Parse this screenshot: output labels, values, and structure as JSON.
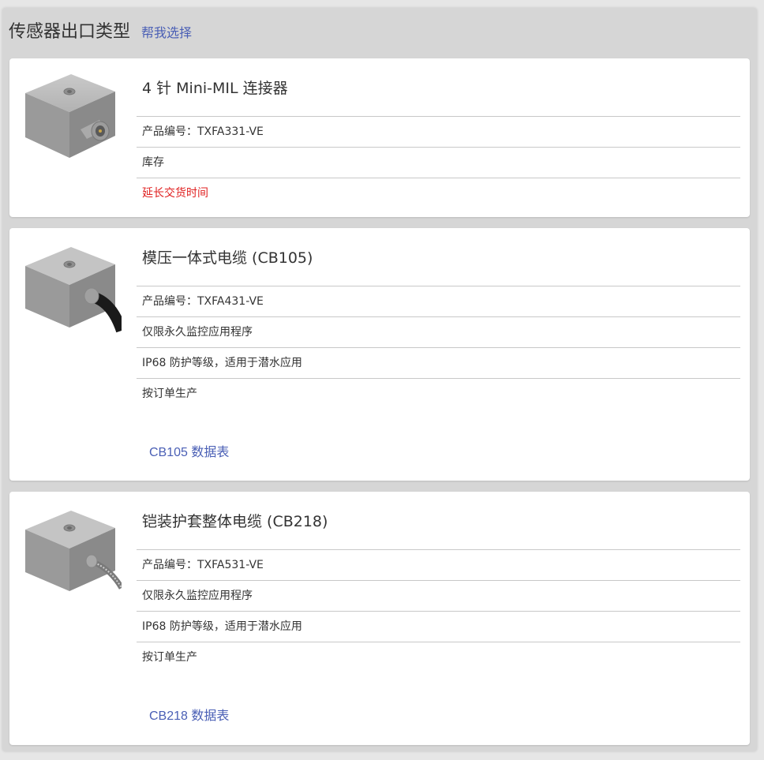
{
  "panel": {
    "title": "传感器出口类型",
    "help_link": "帮我选择"
  },
  "cards": [
    {
      "title": "4 针 Mini-MIL 连接器",
      "rows": [
        "产品编号：TXFA331-VE",
        "库存",
        "延长交货时间"
      ],
      "status_color": "#e02020"
    },
    {
      "title": "模压一体式电缆 (CB105)",
      "rows": [
        "产品编号：TXFA431-VE",
        "仅限永久监控应用程序",
        "IP68 防护等级，适用于潜水应用",
        "按订单生产"
      ],
      "datasheet": "CB105 数据表"
    },
    {
      "title": "铠装护套整体电缆 (CB218)",
      "rows": [
        "产品编号：TXFA531-VE",
        "仅限永久监控应用程序",
        "IP68 防护等级，适用于潜水应用",
        "按订单生产"
      ],
      "datasheet": "CB218 数据表"
    }
  ],
  "images": [
    "sensor-connector-icon",
    "sensor-molded-cable-icon",
    "sensor-armored-cable-icon"
  ]
}
